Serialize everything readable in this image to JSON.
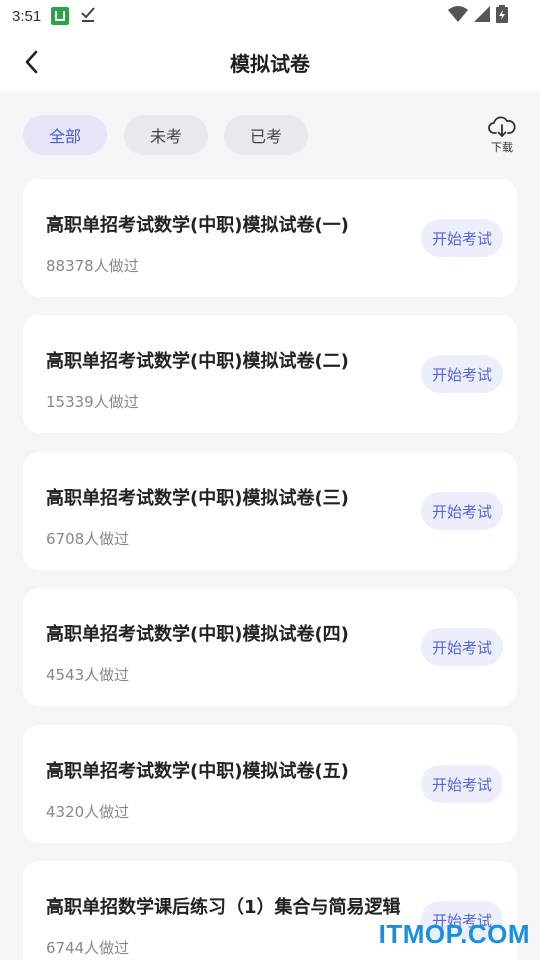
{
  "status_bar": {
    "time": "3:51",
    "icons": [
      "app-u-icon",
      "download-done-icon",
      "wifi-icon",
      "signal-icon",
      "battery-charging-icon"
    ]
  },
  "header": {
    "title": "模拟试卷",
    "back_icon": "chevron-left-icon"
  },
  "filters": {
    "tabs": [
      {
        "label": "全部",
        "active": true
      },
      {
        "label": "未考",
        "active": false
      },
      {
        "label": "已考",
        "active": false
      }
    ],
    "download": {
      "label": "下载",
      "icon": "cloud-download-icon"
    }
  },
  "papers": [
    {
      "title": "高职单招考试数学(中职)模拟试卷(一)",
      "count": "88378人做过",
      "action": "开始考试"
    },
    {
      "title": "高职单招考试数学(中职)模拟试卷(二)",
      "count": "15339人做过",
      "action": "开始考试"
    },
    {
      "title": "高职单招考试数学(中职)模拟试卷(三)",
      "count": "6708人做过",
      "action": "开始考试"
    },
    {
      "title": "高职单招考试数学(中职)模拟试卷(四)",
      "count": "4543人做过",
      "action": "开始考试"
    },
    {
      "title": "高职单招考试数学(中职)模拟试卷(五)",
      "count": "4320人做过",
      "action": "开始考试"
    },
    {
      "title": "高职单招数学课后练习（1）集合与简易逻辑",
      "count": "6744人做过",
      "action": "开始考试"
    }
  ],
  "watermark": "ITMOP.COM",
  "colors": {
    "accent": "#4a5bd6",
    "background": "#f4f5f7",
    "card": "#ffffff",
    "watermark": "#1a8fe0"
  }
}
